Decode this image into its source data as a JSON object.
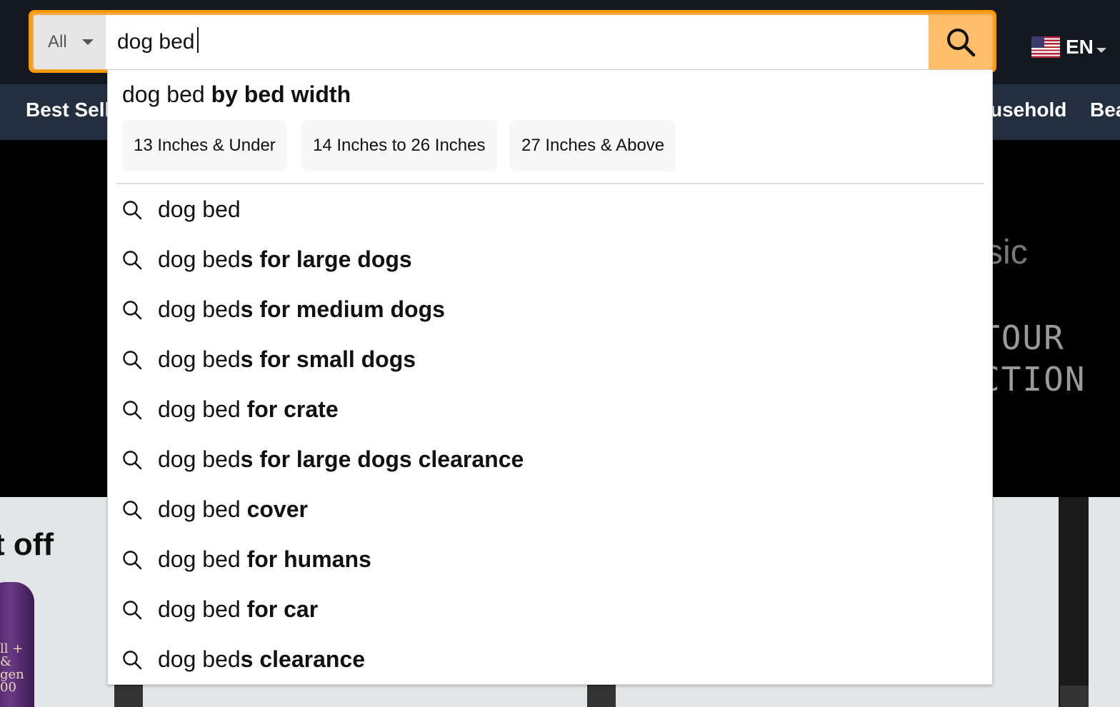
{
  "search": {
    "category": "All",
    "query": "dog bed"
  },
  "language": {
    "code": "EN"
  },
  "nav": {
    "items": [
      "Best Selle",
      "usehold",
      "Bea"
    ]
  },
  "hero": {
    "text_a": "sic",
    "text_b": "TOUR",
    "text_c": "CTION"
  },
  "cards": {
    "left_headline": "t off",
    "bottle_label": "ll +\n&\ngen\n00"
  },
  "dropdown": {
    "header_prefix": "dog bed",
    "header_bold": " by bed width",
    "chips": [
      "13 Inches & Under",
      "14 Inches to 26 Inches",
      "27 Inches & Above"
    ],
    "suggestions": [
      {
        "plain": "dog bed",
        "bold": ""
      },
      {
        "plain": "dog bed",
        "bold": "s for large dogs"
      },
      {
        "plain": "dog bed",
        "bold": "s for medium dogs"
      },
      {
        "plain": "dog bed",
        "bold": "s for small dogs"
      },
      {
        "plain": "dog bed",
        "bold": " for crate"
      },
      {
        "plain": "dog bed",
        "bold": "s for large dogs clearance"
      },
      {
        "plain": "dog bed",
        "bold": " cover"
      },
      {
        "plain": "dog bed",
        "bold": " for humans"
      },
      {
        "plain": "dog bed",
        "bold": " for car"
      },
      {
        "plain": "dog bed",
        "bold": "s clearance"
      }
    ]
  },
  "colors": {
    "topbar": "#131921",
    "navbar": "#232f3e",
    "search_button": "#febd69",
    "focus_outline": "#ff9900"
  }
}
